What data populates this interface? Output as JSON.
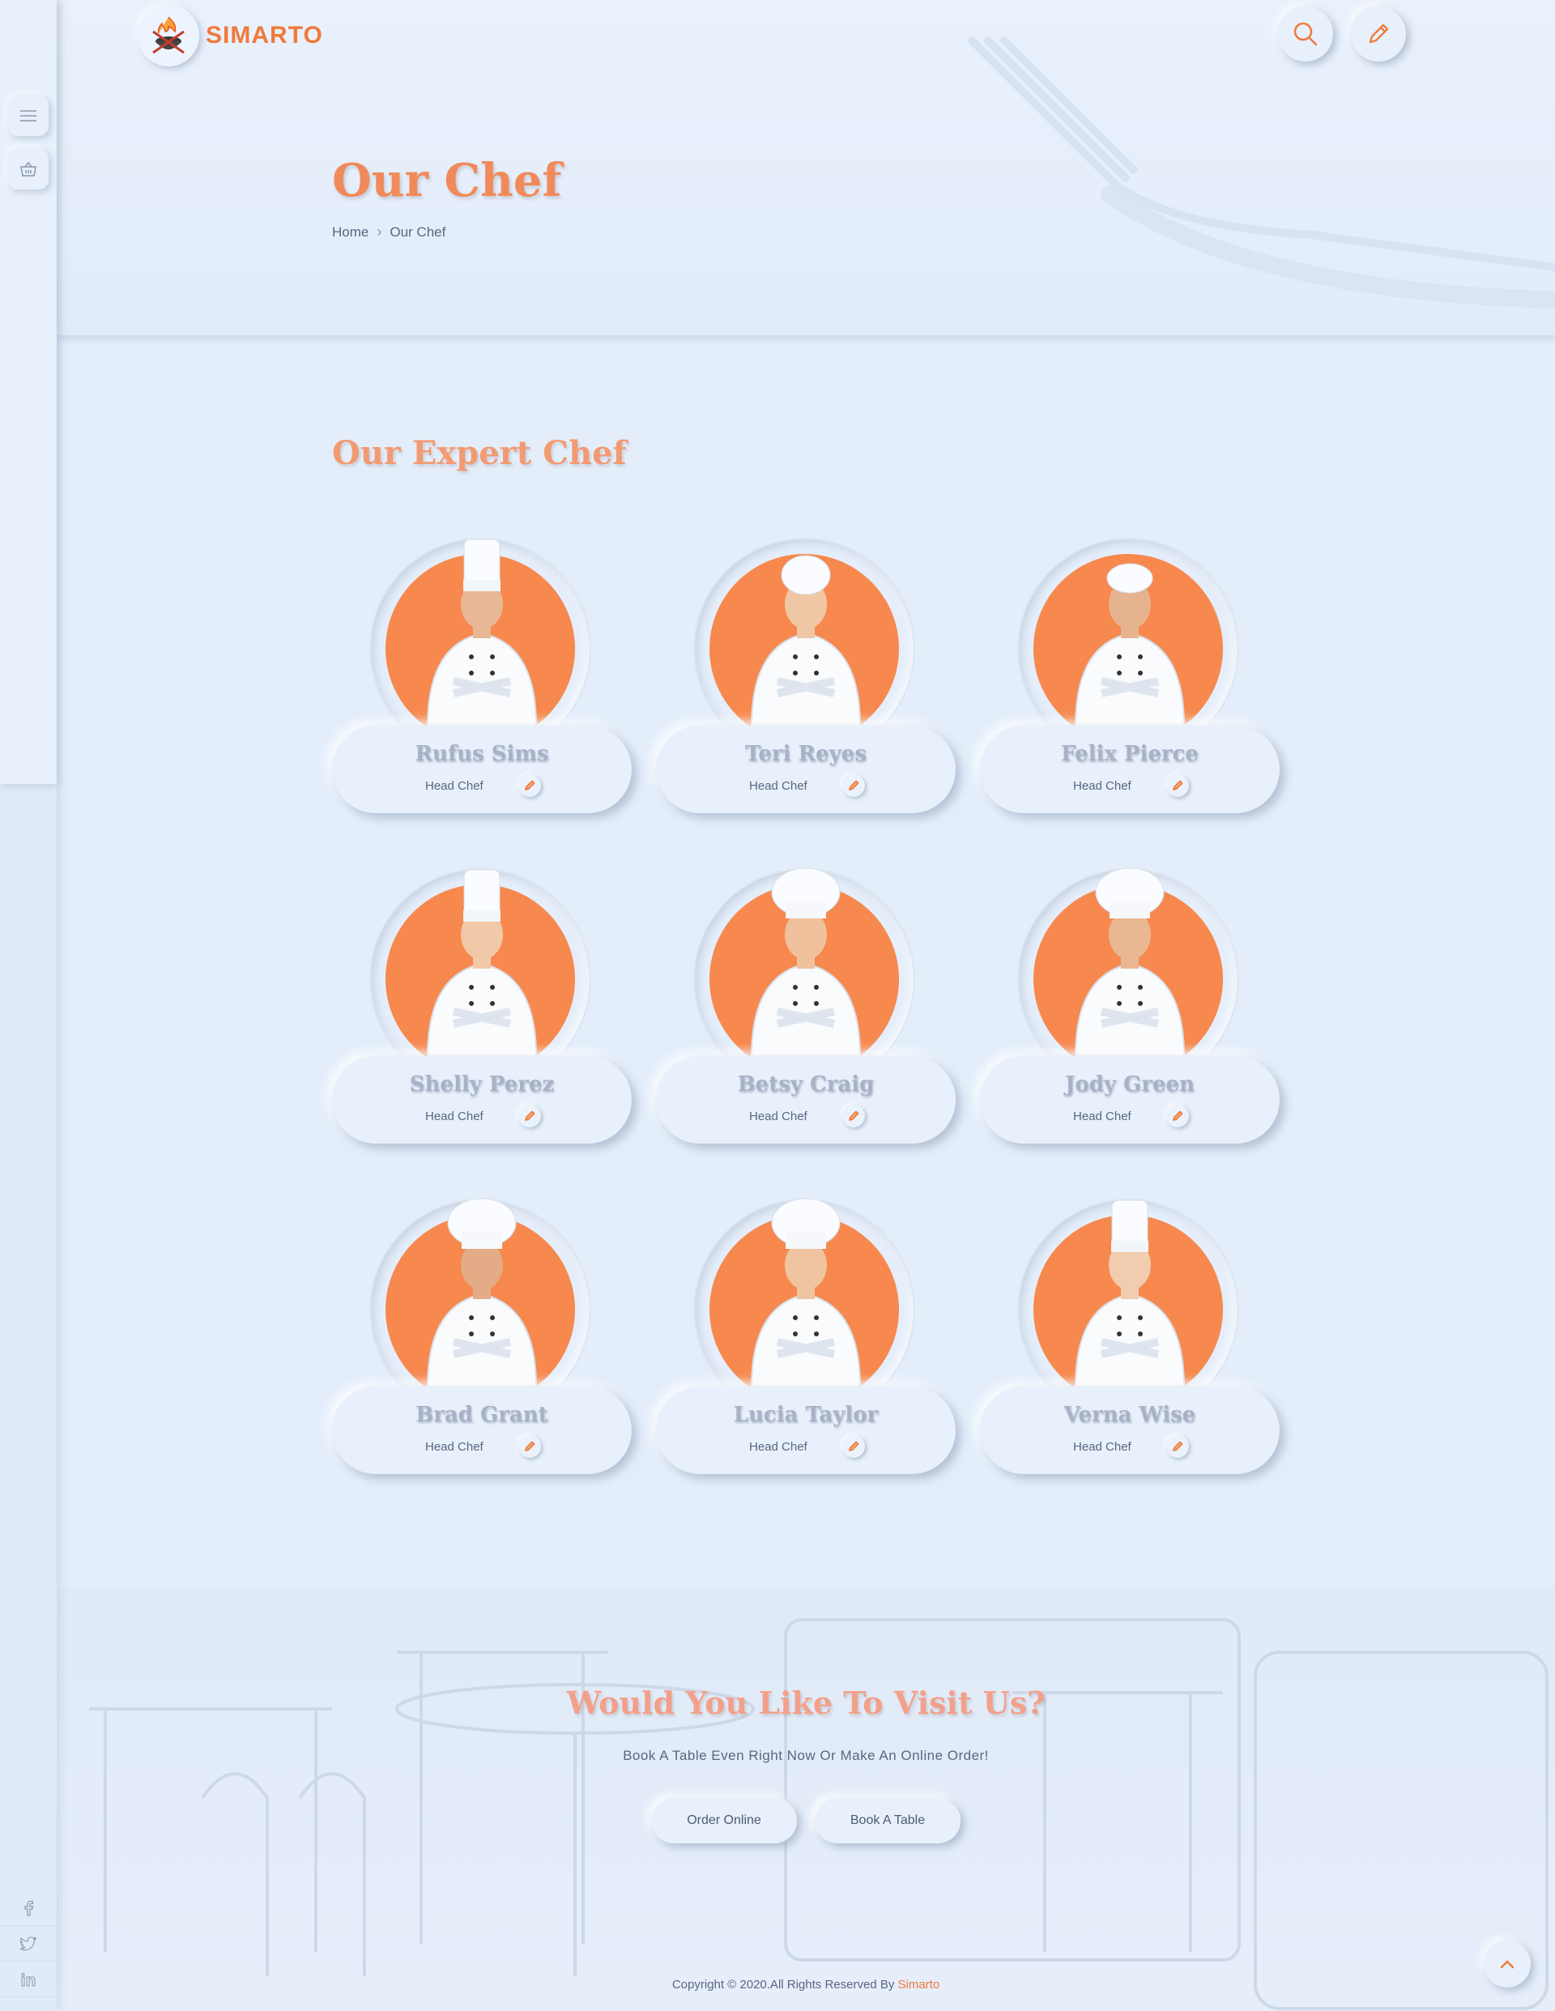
{
  "brand": {
    "name": "SIMARTO",
    "accent": "#f07a3b"
  },
  "header": {
    "page_title": "Our Chef",
    "breadcrumb": [
      "Home",
      "Our Chef"
    ]
  },
  "sidebar": {
    "menu_icon": "hamburger-icon",
    "cart_icon": "basket-icon",
    "socials": [
      "facebook-icon",
      "twitter-icon",
      "linkedin-icon"
    ]
  },
  "section": {
    "title": "Our Expert Chef"
  },
  "chefs": [
    {
      "name": "Rufus Sims",
      "role": "Head Chef"
    },
    {
      "name": "Teri Reyes",
      "role": "Head Chef"
    },
    {
      "name": "Felix Pierce",
      "role": "Head Chef"
    },
    {
      "name": "Shelly Perez",
      "role": "Head Chef"
    },
    {
      "name": "Betsy Craig",
      "role": "Head Chef"
    },
    {
      "name": "Jody Green",
      "role": "Head Chef"
    },
    {
      "name": "Brad Grant",
      "role": "Head Chef"
    },
    {
      "name": "Lucia Taylor",
      "role": "Head Chef"
    },
    {
      "name": "Verna Wise",
      "role": "Head Chef"
    }
  ],
  "cta": {
    "title": "Would You Like To Visit Us?",
    "subtitle": "Book A Table Even Right Now Or Make An Online Order!",
    "order_label": "Order Online",
    "book_label": "Book A Table"
  },
  "footer": {
    "copyright": "Copyright © 2020.All Rights Reserved By ",
    "brand": "Simarto"
  },
  "colors": {
    "background": "#e4eefb",
    "accent_orange": "#f7884e",
    "title_orange": "#f18a5a"
  }
}
